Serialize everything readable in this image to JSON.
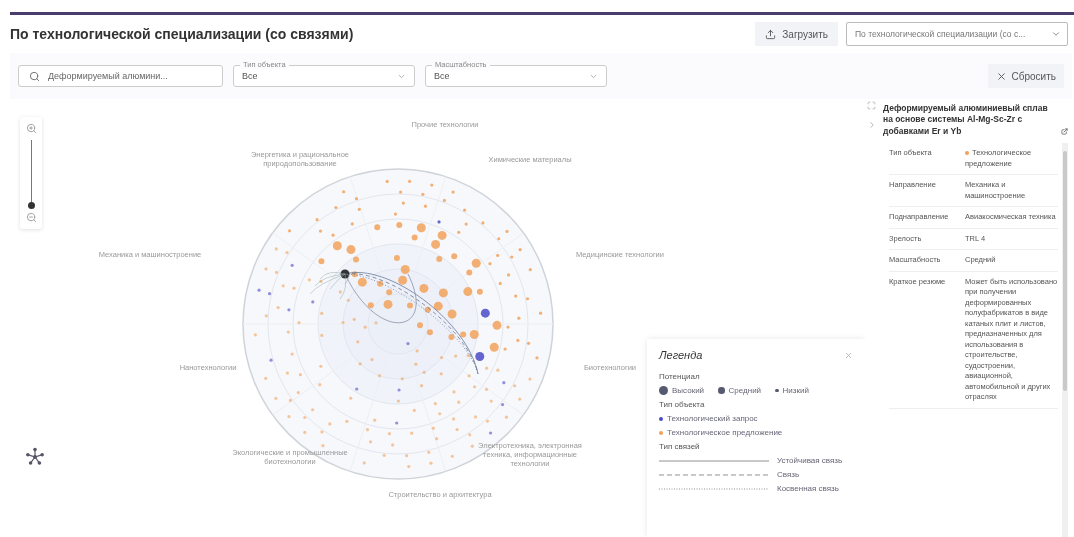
{
  "title": "По технологической специализации (со связями)",
  "upload_button": {
    "label": "Загрузить"
  },
  "view_select": {
    "value": "По технологической специализации (со с..."
  },
  "filters": {
    "search": {
      "value": "Деформируемый алюмини..."
    },
    "selects": [
      {
        "label": "Тип объекта",
        "value": "Все"
      },
      {
        "label": "Масштабность",
        "value": "Все"
      }
    ],
    "reset_button": {
      "label": "Сбросить"
    }
  },
  "zoom": {
    "level": 0
  },
  "chart": {
    "sectors": [
      {
        "label": "Прочие технологии"
      },
      {
        "label": "Химические материалы"
      },
      {
        "label": "Медицинские технологии"
      },
      {
        "label": "Биотехнологии"
      },
      {
        "label": "Электротехника, электронная техника, информационные технологии"
      },
      {
        "label": "Строительство и архитектура"
      },
      {
        "label": "Экологические и промышленные биотехнологии"
      },
      {
        "label": "Нанотехнологии"
      },
      {
        "label": "Механика и машиностроение"
      },
      {
        "label": "Энергетика и рациональное природопользование"
      }
    ]
  },
  "legend": {
    "title": "Легенда",
    "potential": {
      "title": "Потенциал",
      "items": [
        {
          "label": "Высокий",
          "kind": "large"
        },
        {
          "label": "Средний",
          "kind": "medium"
        },
        {
          "label": "Низкий",
          "kind": "small"
        }
      ]
    },
    "object_types": {
      "title": "Тип объекта",
      "items": [
        {
          "label": "Технологический запрос",
          "color": "#4b4bc8"
        },
        {
          "label": "Технологическое предложение",
          "color": "#f2a25a"
        }
      ]
    },
    "link_types": {
      "title": "Тип связей",
      "items": [
        {
          "label": "Устойчивая связь",
          "kind": "solid"
        },
        {
          "label": "Связь",
          "kind": "dashed"
        },
        {
          "label": "Косвенная связь",
          "kind": "dotted"
        }
      ]
    }
  },
  "details": {
    "title": "Деформируемый алюминиевый сплав на основе системы Al-Mg-Sc-Zr с добавками Er и Yb",
    "rows": [
      {
        "label": "Тип объекта",
        "value": "Технологическое предложение",
        "color": "#f2a25a"
      },
      {
        "label": "Направление",
        "value": "Механика и машиностроение"
      },
      {
        "label": "Поднаправление",
        "value": "Авиакосмическая техника"
      },
      {
        "label": "Зрелость",
        "value": "TRL 4"
      },
      {
        "label": "Масштабность",
        "value": "Средний"
      },
      {
        "label": "Краткое резюме",
        "value": "Может быть использовано при получении деформированных полуфабрикатов в виде катаных плит и листов, предназначенных для использования в строительстве, судостроении, авиационной, автомобильной и других отраслях"
      }
    ]
  }
}
